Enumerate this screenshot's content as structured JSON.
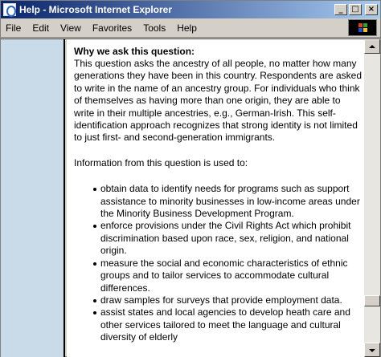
{
  "window": {
    "title": "Help - Microsoft Internet Explorer",
    "buttons": {
      "minimize": "_",
      "maximize": "□",
      "close": "×"
    }
  },
  "menu": {
    "items": [
      {
        "label": "File"
      },
      {
        "label": "Edit"
      },
      {
        "label": "View"
      },
      {
        "label": "Favorites"
      },
      {
        "label": "Tools"
      },
      {
        "label": "Help"
      }
    ]
  },
  "content": {
    "heading": "Why we ask this question:",
    "paragraph": "This question asks the ancestry of all people, no matter how many generations they have been in this country. Respondents are asked to write in the name of an ancestry group. For individuals who think of themselves as having more than one origin, they are able to write in their multiple ancestries, e.g., German-Irish. This self-identification approach recognizes that strong identity is not limited to just first- and second-generation immigrants.",
    "intro": "Information from this question is used to:",
    "bullets": [
      "obtain data to identify needs for programs such as support assistance to minority businesses in low-income areas under the Minority Business Development Program.",
      "enforce provisions under the Civil Rights Act which prohibit discrimination based upon race, sex, religion, and national origin.",
      "measure the social and economic characteristics of ethnic groups and to tailor services to accommodate cultural differences.",
      "draw samples for surveys that provide employment data.",
      "assist states and local agencies to develop heath care and other services tailored to meet the language and cultural diversity of elderly"
    ]
  },
  "colors": {
    "titlebar_start": "#0a246a",
    "titlebar_end": "#a6caf0",
    "left_pane": "#c9dbe8"
  },
  "icons": {
    "title": "ie-icon",
    "throbber": "windows-logo-icon"
  }
}
